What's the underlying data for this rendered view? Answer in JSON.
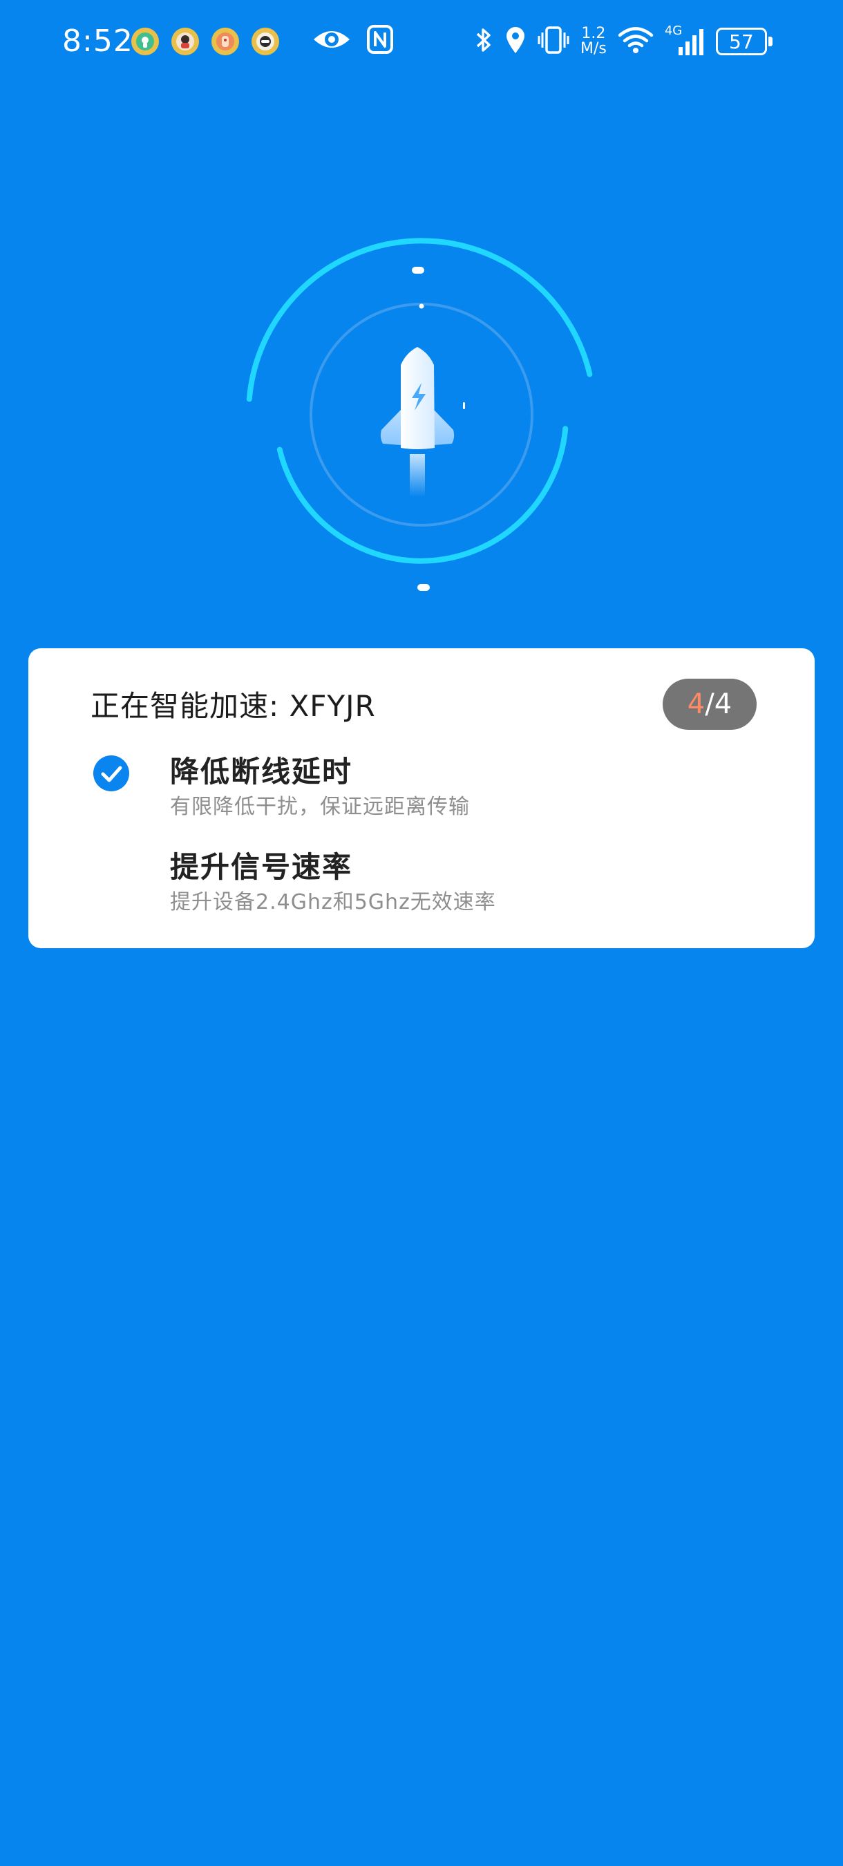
{
  "status_bar": {
    "time": "8:52",
    "net_speed_value": "1.2",
    "net_speed_unit": "M/s",
    "network_type": "4G",
    "battery_level": "57",
    "notification_icons": [
      "app-notification-icon-1",
      "app-notification-icon-2",
      "app-notification-icon-3",
      "app-notification-icon-4"
    ],
    "system_icons": [
      "eye-icon",
      "nfc-icon",
      "bluetooth-icon",
      "location-icon",
      "vibrate-icon",
      "wifi-icon",
      "signal-icon"
    ]
  },
  "hero": {
    "icon": "rocket-icon",
    "ring_color": "#20D8FF",
    "inner_ring_color": "#3A9BEF"
  },
  "card": {
    "title": "正在智能加速: XFYJR",
    "progress": {
      "current": "4",
      "separator": "/",
      "total": "4"
    },
    "tasks": [
      {
        "title": "降低断线延时",
        "description": "有限降低干扰，保证远距离传输",
        "done": true,
        "icon": "check-circle-icon"
      },
      {
        "title": "提升信号速率",
        "description": "提升设备2.4Ghz和5Ghz无效速率",
        "done": false
      }
    ]
  },
  "colors": {
    "background": "#0785EE",
    "accent": "#0A84EE",
    "progress_highlight": "#FF8A65",
    "badge": "#757575"
  }
}
